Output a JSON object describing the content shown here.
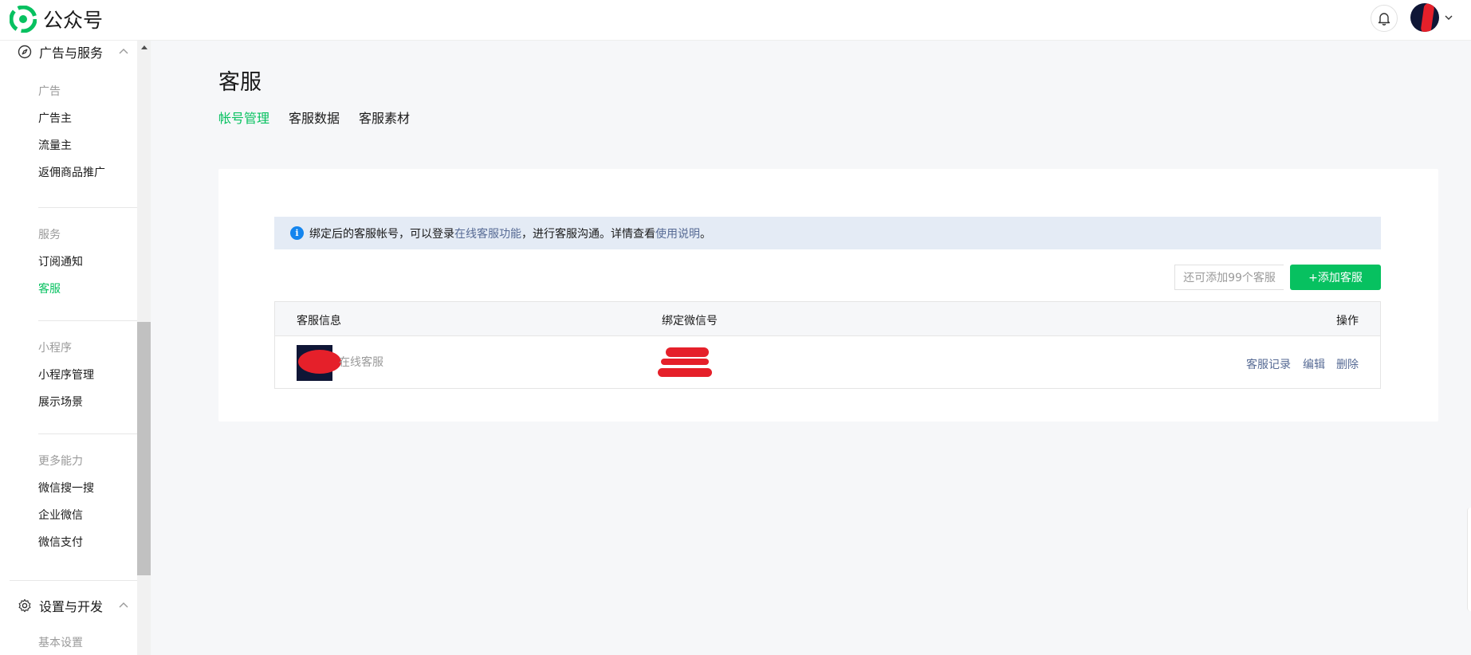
{
  "header": {
    "app_name": "公众号",
    "bell_icon": "bell-icon",
    "brand_color": "#07c160"
  },
  "sidebar": {
    "section_ads": {
      "title": "广告与服务",
      "icon": "compass-icon"
    },
    "groups": {
      "ads_label": "广告",
      "service_label": "服务",
      "miniprogram_label": "小程序",
      "more_label": "更多能力"
    },
    "items": {
      "advertiser": "广告主",
      "publisher": "流量主",
      "rebate": "返佣商品推广",
      "subscribe": "订阅通知",
      "customer_service": "客服",
      "mp_manage": "小程序管理",
      "showcase": "展示场景",
      "search": "微信搜一搜",
      "work_wechat": "企业微信",
      "pay": "微信支付"
    },
    "section_settings": {
      "title": "设置与开发",
      "icon": "gear-icon"
    },
    "settings_items": {
      "basic": "基本设置"
    }
  },
  "main": {
    "title": "客服",
    "tabs": [
      "帐号管理",
      "客服数据",
      "客服素材"
    ],
    "notice": {
      "text1": "绑定后的客服帐号，可以登录",
      "link1": "在线客服功能",
      "text2": "，进行客服沟通。详情查看",
      "link2": "使用说明",
      "text3": "。"
    },
    "quota_text": "还可添加99个客服",
    "add_button": "+添加客服",
    "table": {
      "columns": {
        "info": "客服信息",
        "wechat": "绑定微信号",
        "ops": "操作"
      },
      "rows": [
        {
          "name": "在线客服",
          "ops": [
            "客服记录",
            "编辑",
            "删除"
          ]
        }
      ]
    }
  }
}
